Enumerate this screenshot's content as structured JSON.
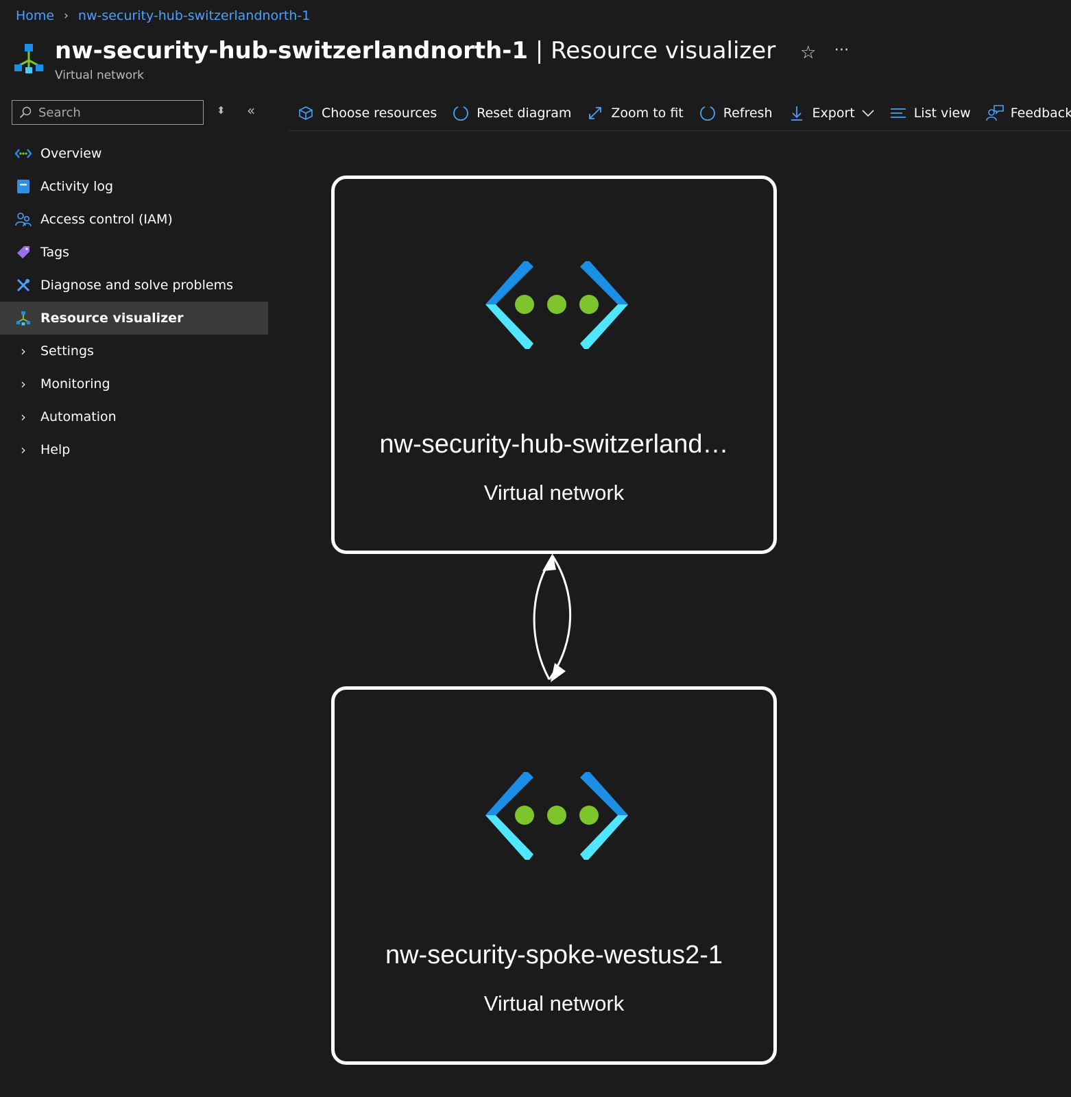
{
  "breadcrumb": {
    "home": "Home",
    "current": "nw-security-hub-switzerlandnorth-1"
  },
  "header": {
    "resource_name": "nw-security-hub-switzerlandnorth-1",
    "page_name": "| Resource visualizer",
    "subtitle": "Virtual network",
    "star_icon": "star-icon",
    "more_icon": "more-icon"
  },
  "search": {
    "placeholder": "Search"
  },
  "nav": {
    "overview": "Overview",
    "activity_log": "Activity log",
    "access_control": "Access control (IAM)",
    "tags": "Tags",
    "diagnose": "Diagnose and solve problems",
    "resource_visualizer": "Resource visualizer",
    "settings": "Settings",
    "monitoring": "Monitoring",
    "automation": "Automation",
    "help": "Help"
  },
  "toolbar": {
    "choose_resources": "Choose resources",
    "reset_diagram": "Reset diagram",
    "zoom_to_fit": "Zoom to fit",
    "refresh": "Refresh",
    "export": "Export",
    "list_view": "List view",
    "feedback": "Feedback"
  },
  "diagram": {
    "nodes": [
      {
        "name": "nw-security-hub-switzerland…",
        "type": "Virtual network"
      },
      {
        "name": "nw-security-spoke-westus2-1",
        "type": "Virtual network"
      }
    ]
  },
  "colors": {
    "background": "#1b1b1b",
    "link": "#4aa0ff",
    "active_nav": "#3a3a3a",
    "vnet_dark_blue": "#1b8fe6",
    "vnet_light_blue": "#50e6ff",
    "vnet_green": "#7dc42d"
  }
}
